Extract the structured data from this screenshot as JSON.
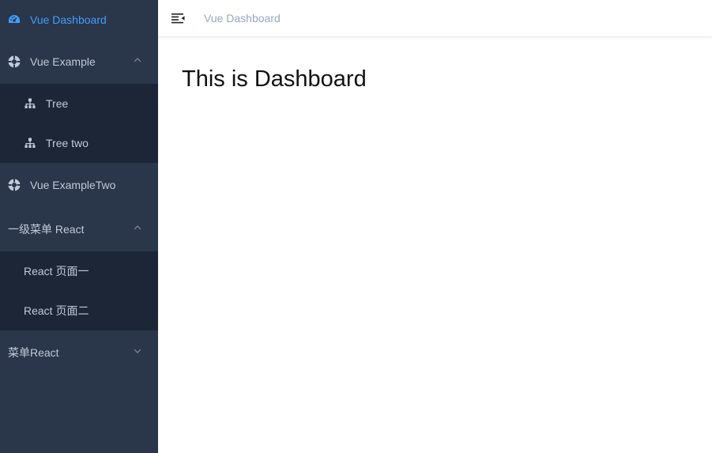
{
  "sidebar": {
    "logo_item": {
      "label": "Vue Dashboard",
      "icon": "dashboard-icon"
    },
    "vue_example": {
      "label": "Vue Example",
      "icon": "target-icon",
      "expanded": true,
      "children": [
        {
          "label": "Tree",
          "icon": "tree-icon"
        },
        {
          "label": "Tree two",
          "icon": "tree-icon"
        }
      ]
    },
    "vue_example_two": {
      "label": "Vue ExampleTwo",
      "icon": "target-icon"
    },
    "react_menu": {
      "label": "一级菜单 React",
      "expanded": true,
      "children": [
        {
          "label": "React 页面一"
        },
        {
          "label": "React 页面二"
        }
      ]
    },
    "react_menu_two": {
      "label": "菜单React",
      "expanded": false
    }
  },
  "navbar": {
    "breadcrumb": "Vue Dashboard",
    "toggle_icon": "hamburger-icon"
  },
  "main": {
    "title": "This is Dashboard"
  },
  "colors": {
    "sidebar_bg": "#2a3649",
    "submenu_bg": "#1d2636",
    "menu_text": "#bfcbd9",
    "active": "#409eff",
    "breadcrumb": "#97a8be"
  }
}
